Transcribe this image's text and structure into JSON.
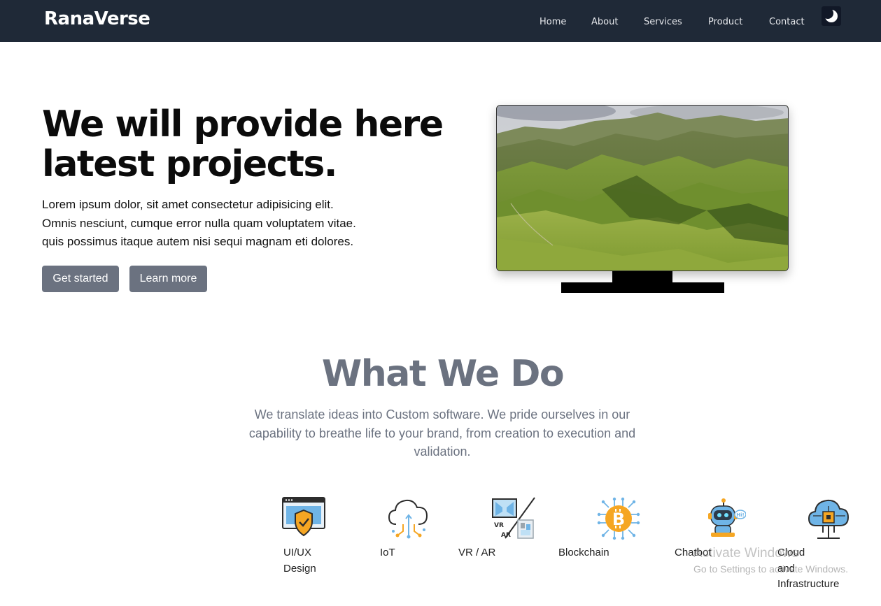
{
  "navbar": {
    "brand": "RanaVerse",
    "links": [
      "Home",
      "About",
      "Services",
      "Product",
      "Contact"
    ],
    "theme_toggle_icon": "moon-icon",
    "background": "#1f2937"
  },
  "hero": {
    "title_line1": "We will provide here",
    "title_line2": "latest projects.",
    "text_lines": [
      "Lorem ipsum dolor, sit amet consectetur adipisicing elit.",
      "Omnis nesciunt, cumque error nulla quam voluptatem vitae.",
      "quis possimus itaque autem nisi sequi magnam eti dolores."
    ],
    "primary_button": "Get started",
    "secondary_button": "Learn more",
    "button_color": "#6b7280",
    "image_icon": "monitor-mountain-landscape"
  },
  "what_we_do": {
    "title": "What We Do",
    "text_lines": [
      "We translate ideas into Custom software. We pride ourselves in our",
      "capability to breathe life to your brand, from creation to execution and",
      "validation."
    ],
    "title_color": "#6b7280",
    "services": [
      {
        "icon": "ui-ux-design-icon",
        "label_lines": [
          "UI/UX",
          "Design"
        ]
      },
      {
        "icon": "iot-cloud-icon",
        "label_lines": [
          "IoT"
        ]
      },
      {
        "icon": "vr-ar-icon",
        "label_lines": [
          "VR / AR"
        ]
      },
      {
        "icon": "blockchain-icon",
        "label_lines": [
          "Blockchain"
        ]
      },
      {
        "icon": "chatbot-icon",
        "label_lines": [
          "Chatbot"
        ]
      },
      {
        "icon": "cloud-infrastructure-icon",
        "label_lines": [
          "Cloud",
          "and",
          "Infrastructure"
        ]
      }
    ]
  },
  "watermark": {
    "title": "Activate Windows",
    "subtitle": "Go to Settings to activate Windows."
  }
}
